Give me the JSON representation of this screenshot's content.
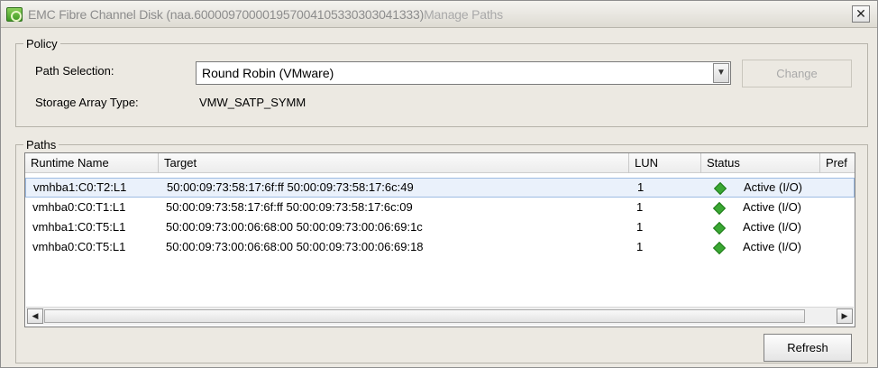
{
  "window": {
    "title": "EMC Fibre Channel Disk (naa.600009700001957004105330303041333)",
    "title_suffix": "Manage Paths",
    "close_glyph": "✕"
  },
  "policy": {
    "legend": "Policy",
    "path_selection_label": "Path Selection:",
    "path_selection_value": "Round Robin (VMware)",
    "change_label": "Change",
    "storage_array_type_label": "Storage Array Type:",
    "storage_array_type_value": "VMW_SATP_SYMM"
  },
  "paths": {
    "legend": "Paths",
    "columns": [
      "Runtime Name",
      "Target",
      "LUN",
      "Status",
      "Pref"
    ],
    "rows": [
      {
        "runtime": "vmhba1:C0:T2:L1",
        "target": "50:00:09:73:58:17:6f:ff 50:00:09:73:58:17:6c:49",
        "lun": "1",
        "status": "Active (I/O)"
      },
      {
        "runtime": "vmhba0:C0:T1:L1",
        "target": "50:00:09:73:58:17:6f:ff 50:00:09:73:58:17:6c:09",
        "lun": "1",
        "status": "Active (I/O)"
      },
      {
        "runtime": "vmhba1:C0:T5:L1",
        "target": "50:00:09:73:00:06:68:00 50:00:09:73:00:06:69:1c",
        "lun": "1",
        "status": "Active (I/O)"
      },
      {
        "runtime": "vmhba0:C0:T5:L1",
        "target": "50:00:09:73:00:06:68:00 50:00:09:73:00:06:69:18",
        "lun": "1",
        "status": "Active (I/O)"
      }
    ],
    "status_color": "#3aa733",
    "refresh_label": "Refresh"
  },
  "icons": {
    "app": "emc-disk-icon",
    "dropdown": "chevron-down-icon",
    "status": "green-diamond-icon",
    "scroll_left": "arrow-left-icon",
    "scroll_right": "arrow-right-icon"
  }
}
